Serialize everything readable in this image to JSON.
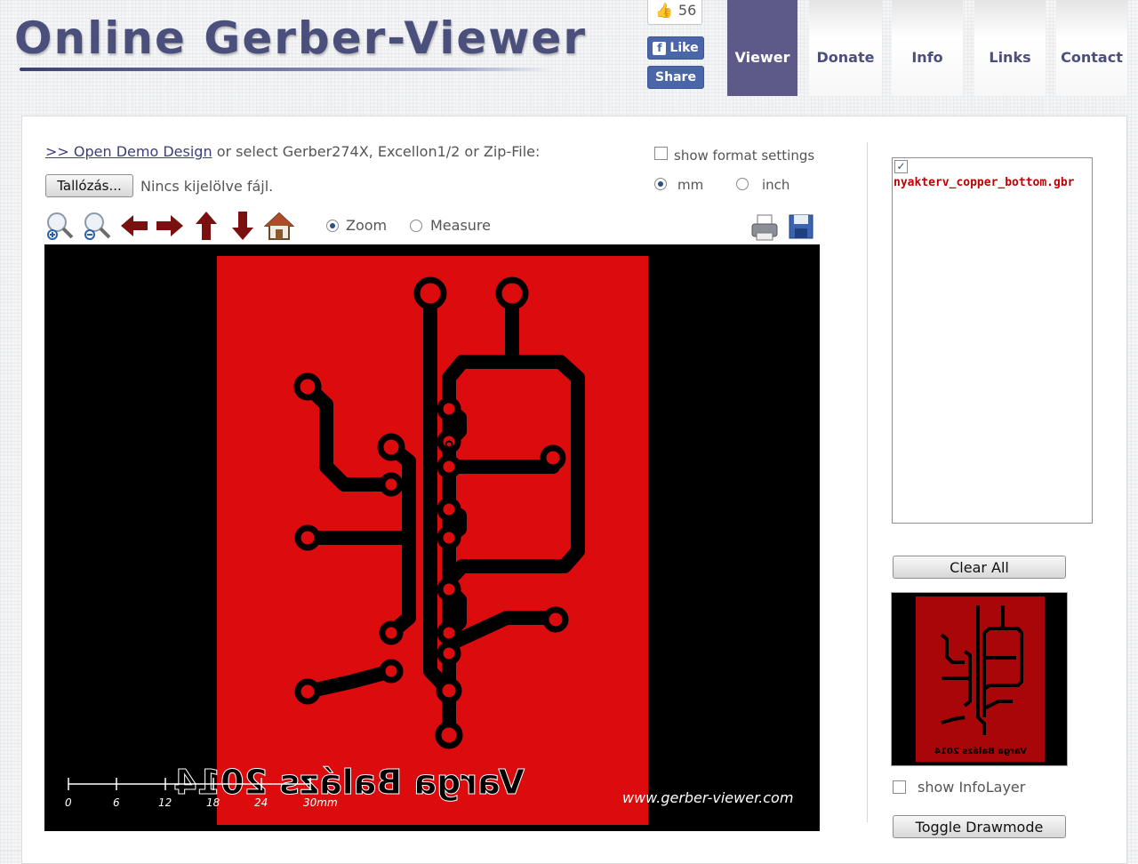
{
  "header": {
    "logo_text": "Online Gerber-Viewer",
    "like_count": "56",
    "like_label": "Like",
    "share_label": "Share",
    "nav": [
      "Viewer",
      "Donate",
      "Info",
      "Links",
      "Contact"
    ],
    "active_tab": "Viewer"
  },
  "file_section": {
    "demo_link": ">> Open Demo Design",
    "select_text": "or select Gerber274X, Excellon1/2 or Zip-File:",
    "browse_button": "Tallózás...",
    "no_file_text": "Nincs kijelölve fájl."
  },
  "settings": {
    "show_format_settings": "show format settings",
    "unit_mm": "mm",
    "unit_inch": "inch",
    "selected_unit": "mm"
  },
  "toolbar": {
    "icons": [
      "zoom-in-icon",
      "zoom-out-icon",
      "arrow-left-icon",
      "arrow-right-icon",
      "arrow-up-icon",
      "arrow-down-icon",
      "home-icon",
      "print-icon",
      "save-icon"
    ],
    "mode_zoom": "Zoom",
    "mode_measure": "Measure",
    "selected_mode": "Zoom"
  },
  "viewer": {
    "board_text": "Varga Balázs 2014",
    "watermark": "www.gerber-viewer.com",
    "scale_labels": [
      "0",
      "6",
      "12",
      "18",
      "24",
      "30mm"
    ],
    "colors": {
      "background": "#000000",
      "board": "#dc0b0e",
      "traces": "#000000"
    }
  },
  "sidebar": {
    "layers": [
      {
        "name": "nyakterv_copper_bottom.gbr",
        "checked": true,
        "color": "#c00000"
      }
    ],
    "clear_all": "Clear All",
    "show_infolayer": "show InfoLayer",
    "toggle_drawmode": "Toggle Drawmode"
  }
}
